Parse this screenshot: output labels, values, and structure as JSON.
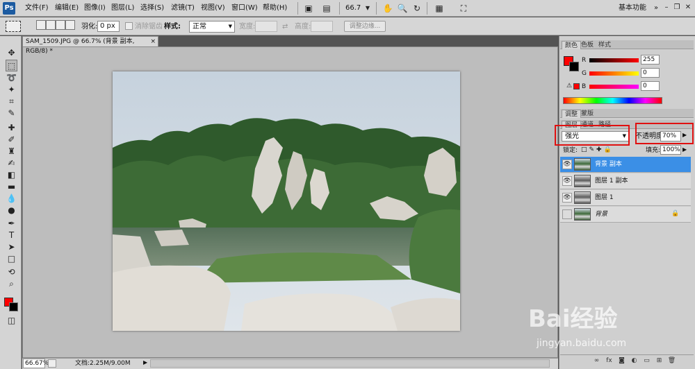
{
  "app": {
    "logo": "Ps"
  },
  "menu": [
    "文件(F)",
    "编辑(E)",
    "图像(I)",
    "图层(L)",
    "选择(S)",
    "滤镜(T)",
    "视图(V)",
    "窗口(W)",
    "帮助(H)"
  ],
  "menubar_tools": {
    "zoom": "66.7",
    "workspace": "基本功能"
  },
  "options": {
    "feather_label": "羽化:",
    "feather_value": "0 px",
    "antialias_label": "消除锯齿",
    "style_label": "样式:",
    "style_value": "正常",
    "width_label": "宽度:",
    "height_label": "高度:",
    "refine_button": "调整边缘..."
  },
  "document": {
    "tab_title": "SAM_1509.JPG @ 66.7% (背景 副本, RGB/8) *",
    "status_zoom": "66.67%",
    "status_doc": "文档:2.25M/9.00M"
  },
  "color_panel": {
    "tabs": [
      "颜色",
      "色板",
      "样式"
    ],
    "channels": [
      {
        "label": "R",
        "value": "255"
      },
      {
        "label": "G",
        "value": "0"
      },
      {
        "label": "B",
        "value": "0"
      }
    ]
  },
  "adjust_panel": {
    "tabs": [
      "调整",
      "蒙版"
    ]
  },
  "layers_panel": {
    "tabs": [
      "图层",
      "通道",
      "路径"
    ],
    "blend_mode": "强光",
    "opacity_label": "不透明度:",
    "opacity_value": "70%",
    "lock_label": "锁定:",
    "fill_label": "填充:",
    "fill_value": "100%",
    "layers": [
      {
        "name": "背景 副本",
        "visible": true,
        "selected": true
      },
      {
        "name": "图层 1 副本",
        "visible": true,
        "selected": false
      },
      {
        "name": "图层 1",
        "visible": true,
        "selected": false
      },
      {
        "name": "背景",
        "visible": false,
        "selected": false,
        "locked": true
      }
    ]
  },
  "watermark": {
    "main": "Bai经验",
    "sub": "jingyan.baidu.com"
  },
  "colors": {
    "foreground": "#ff0000",
    "background": "#000000",
    "selection": "#3b8fe6",
    "highlight_box": "#e01010"
  }
}
